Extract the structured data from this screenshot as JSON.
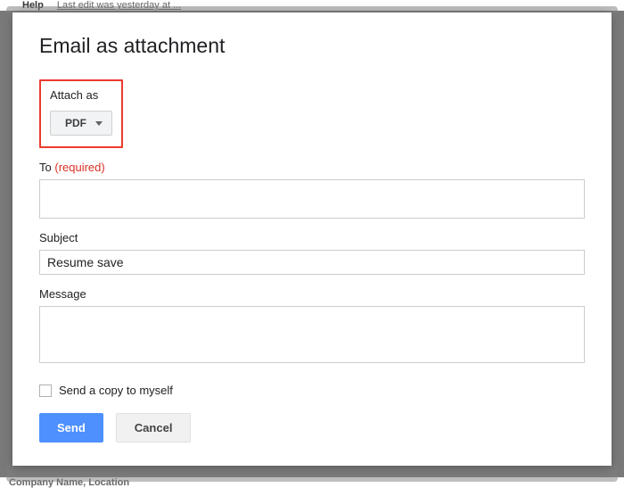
{
  "backdrop": {
    "menu_item_1": "",
    "menu_item_2": "Help",
    "edit_status": "Last edit was yesterday at ...",
    "bottom_text": "Company Name, Location"
  },
  "dialog": {
    "title": "Email as attachment",
    "attach_as": {
      "label": "Attach as",
      "value": "PDF"
    },
    "to": {
      "label": "To",
      "required_text": "(required)",
      "value": ""
    },
    "subject": {
      "label": "Subject",
      "value": "Resume save"
    },
    "message": {
      "label": "Message",
      "value": ""
    },
    "send_copy_label": "Send a copy to myself",
    "buttons": {
      "send": "Send",
      "cancel": "Cancel"
    }
  }
}
